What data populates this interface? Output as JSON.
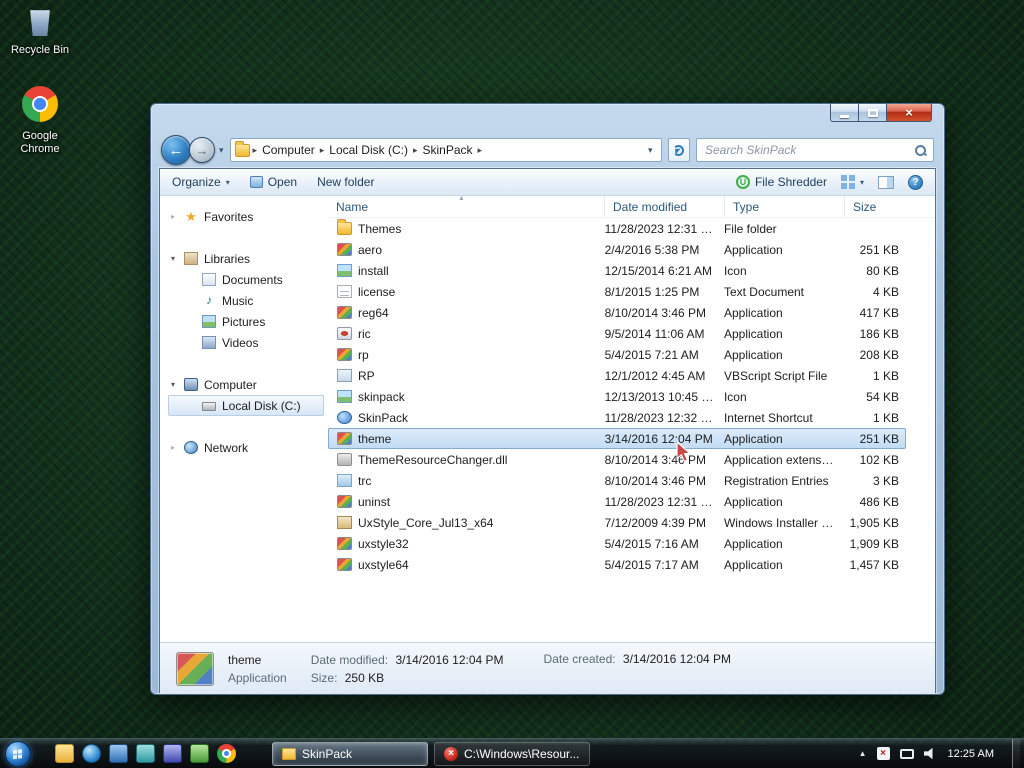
{
  "glyphs": {
    "back": "←",
    "forward": "→",
    "dropdown": "▾",
    "crumb_sep": "▸",
    "expand": "▸",
    "collapse": "▾",
    "star": "★",
    "music": "♪",
    "close": "×",
    "help": "?",
    "shredder": "U",
    "sort_asc": "▲",
    "tray_expand": "▲",
    "error_x": "×"
  },
  "desktop": {
    "icons": [
      {
        "label": "Recycle Bin"
      },
      {
        "label": "Google Chrome"
      }
    ]
  },
  "window": {
    "address": {
      "crumbs": [
        "Computer",
        "Local Disk (C:)",
        "SkinPack"
      ],
      "search_placeholder": "Search SkinPack"
    },
    "toolbar": {
      "organize": "Organize",
      "open": "Open",
      "new_folder": "New folder",
      "file_shredder": "File Shredder"
    },
    "sidebar": {
      "items": [
        {
          "label": "Favorites",
          "icon": "star",
          "level": 0,
          "expander": "closed"
        },
        {
          "label": "Libraries",
          "icon": "libraries",
          "level": 0,
          "expander": "open",
          "gap": true
        },
        {
          "label": "Documents",
          "icon": "documents",
          "level": 1
        },
        {
          "label": "Music",
          "icon": "music",
          "level": 1
        },
        {
          "label": "Pictures",
          "icon": "pictures",
          "level": 1
        },
        {
          "label": "Videos",
          "icon": "videos",
          "level": 1
        },
        {
          "label": "Computer",
          "icon": "computer",
          "level": 0,
          "expander": "open",
          "gap": true
        },
        {
          "label": "Local Disk (C:)",
          "icon": "disk",
          "level": 1,
          "selected": true
        },
        {
          "label": "Network",
          "icon": "network",
          "level": 0,
          "expander": "closed",
          "gap": true
        }
      ]
    },
    "columns": [
      "Name",
      "Date modified",
      "Type",
      "Size"
    ],
    "files": [
      {
        "name": "Themes",
        "modified": "11/28/2023 12:31 …",
        "type": "File folder",
        "size": "",
        "icon": "folder"
      },
      {
        "name": "aero",
        "modified": "2/4/2016 5:38 PM",
        "type": "Application",
        "size": "251 KB",
        "icon": "app"
      },
      {
        "name": "install",
        "modified": "12/15/2014 6:21 AM",
        "type": "Icon",
        "size": "80 KB",
        "icon": "ico"
      },
      {
        "name": "license",
        "modified": "8/1/2015 1:25 PM",
        "type": "Text Document",
        "size": "4 KB",
        "icon": "txt"
      },
      {
        "name": "reg64",
        "modified": "8/10/2014 3:46 PM",
        "type": "Application",
        "size": "417 KB",
        "icon": "app"
      },
      {
        "name": "ric",
        "modified": "9/5/2014 11:06 AM",
        "type": "Application",
        "size": "186 KB",
        "icon": "app2"
      },
      {
        "name": "rp",
        "modified": "5/4/2015 7:21 AM",
        "type": "Application",
        "size": "208 KB",
        "icon": "app"
      },
      {
        "name": "RP",
        "modified": "12/1/2012 4:45 AM",
        "type": "VBScript Script File",
        "size": "1 KB",
        "icon": "vbs"
      },
      {
        "name": "skinpack",
        "modified": "12/13/2013 10:45 …",
        "type": "Icon",
        "size": "54 KB",
        "icon": "ico"
      },
      {
        "name": "SkinPack",
        "modified": "11/28/2023 12:32 …",
        "type": "Internet Shortcut",
        "size": "1 KB",
        "icon": "url"
      },
      {
        "name": "theme",
        "modified": "3/14/2016 12:04 PM",
        "type": "Application",
        "size": "251 KB",
        "icon": "app",
        "selected": true
      },
      {
        "name": "ThemeResourceChanger.dll",
        "modified": "8/10/2014 3:46 PM",
        "type": "Application extens…",
        "size": "102 KB",
        "icon": "dll"
      },
      {
        "name": "trc",
        "modified": "8/10/2014 3:46 PM",
        "type": "Registration Entries",
        "size": "3 KB",
        "icon": "reg"
      },
      {
        "name": "uninst",
        "modified": "11/28/2023 12:31 …",
        "type": "Application",
        "size": "486 KB",
        "icon": "app"
      },
      {
        "name": "UxStyle_Core_Jul13_x64",
        "modified": "7/12/2009 4:39 PM",
        "type": "Windows Installer …",
        "size": "1,905 KB",
        "icon": "msi"
      },
      {
        "name": "uxstyle32",
        "modified": "5/4/2015 7:16 AM",
        "type": "Application",
        "size": "1,909 KB",
        "icon": "app"
      },
      {
        "name": "uxstyle64",
        "modified": "5/4/2015 7:17 AM",
        "type": "Application",
        "size": "1,457 KB",
        "icon": "app"
      }
    ],
    "details": {
      "name": "theme",
      "type": "Application",
      "date_modified_label": "Date modified:",
      "date_modified": "3/14/2016 12:04 PM",
      "size_label": "Size:",
      "size": "250 KB",
      "date_created_label": "Date created:",
      "date_created": "3/14/2016 12:04 PM"
    }
  },
  "taskbar": {
    "pinned": [
      "explorer",
      "media-player",
      "app-blue",
      "app-teal",
      "app-indigo",
      "app-green",
      "chrome"
    ],
    "buttons": [
      {
        "label": "SkinPack",
        "icon": "folder",
        "active": true
      },
      {
        "label": "C:\\Windows\\Resour...",
        "icon": "error",
        "active": false
      }
    ],
    "clock": "12:25 AM"
  }
}
